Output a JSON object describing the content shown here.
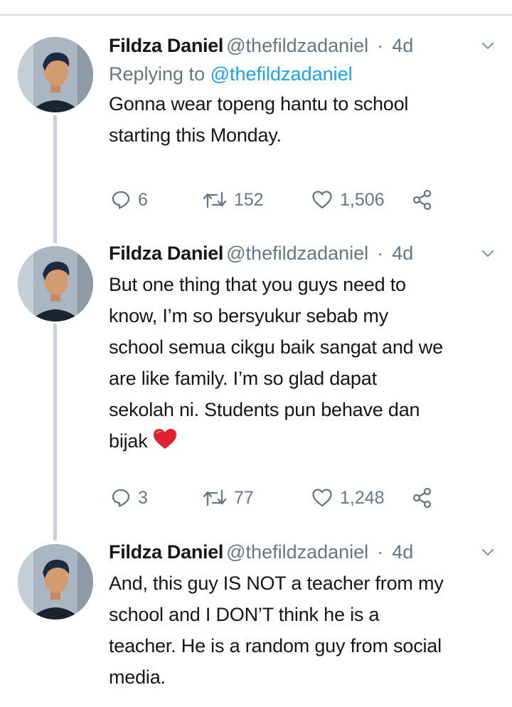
{
  "thread": [
    {
      "author": {
        "name": "Fildza Daniel",
        "handle": "@thefildzadaniel"
      },
      "separator": "·",
      "time": "4d",
      "replying_to": {
        "prefix": "Replying to ",
        "mention": "@thefildzadaniel"
      },
      "text_lines": [
        "Gonna wear topeng hantu to school",
        "starting this Monday."
      ],
      "emoji": null,
      "stats": {
        "replies": "6",
        "retweets": "152",
        "likes": "1,506"
      }
    },
    {
      "author": {
        "name": "Fildza Daniel",
        "handle": "@thefildzadaniel"
      },
      "separator": "·",
      "time": "4d",
      "text_lines": [
        "But one thing that you guys need to",
        "know, I’m so bersyukur sebab my",
        "school semua cikgu baik sangat and we",
        "are like family. I’m so glad dapat",
        "sekolah ni. Students pun behave dan",
        "bijak"
      ],
      "emoji": "red-heart",
      "stats": {
        "replies": "3",
        "retweets": "77",
        "likes": "1,248"
      }
    },
    {
      "author": {
        "name": "Fildza Daniel",
        "handle": "@thefildzadaniel"
      },
      "separator": "·",
      "time": "4d",
      "text_lines": [
        "And, this guy IS NOT a teacher from my",
        "school and I DON’T think he is a",
        "teacher. He is a random guy from social",
        "media."
      ],
      "emoji": null
    }
  ],
  "icons": {
    "reply": "reply-icon",
    "retweet": "retweet-icon",
    "like": "heart-icon",
    "share": "share-icon",
    "caret": "chevron-down-icon"
  },
  "colors": {
    "text": "#14171a",
    "muted": "#657786",
    "link": "#1da1f2",
    "thread_line": "#c8d1d9",
    "heart_emoji": "#e0202e"
  }
}
